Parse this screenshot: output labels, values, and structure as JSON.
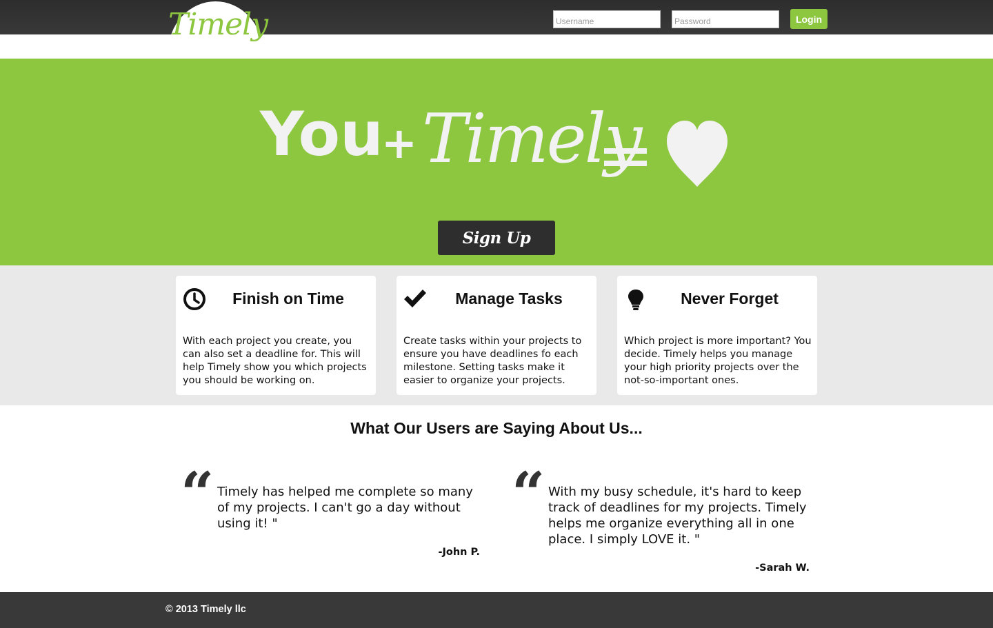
{
  "header": {
    "logo_text": "Timely",
    "username_placeholder": "Username",
    "password_placeholder": "Password",
    "login_label": "Login"
  },
  "hero": {
    "you": "You",
    "plus": "+",
    "brand": "Timely",
    "heart_icon": "heart-icon",
    "signup_label": "Sign Up"
  },
  "features": [
    {
      "icon": "clock-icon",
      "title": "Finish on Time",
      "text": "With each project you create, you can also set a deadline for. This will help Timely show you which projects you should be working on."
    },
    {
      "icon": "checkmark-icon",
      "title": "Manage Tasks",
      "text": "Create tasks within your projects to ensure you have deadlines fo each milestone. Setting tasks make it easier to organize your projects."
    },
    {
      "icon": "lightbulb-icon",
      "title": "Never Forget",
      "text": "Which project is more important? You decide. Timely helps you manage your high priority projects over the not-so-important ones."
    }
  ],
  "testimonials": {
    "heading": "What Our Users are Saying About Us...",
    "items": [
      {
        "quote_icon": "quote-icon",
        "quote_mark": "“",
        "text": "Timely has helped me complete so many of my projects. I can't go a day without using it! \"",
        "author": "-John P."
      },
      {
        "quote_icon": "quote-icon",
        "quote_mark": "“",
        "text": "With my busy schedule, it's hard to keep track of deadlines for my projects. Timely helps me organize everything all in one place. I simply LOVE it. \"",
        "author": "-Sarah W."
      }
    ]
  },
  "footer": {
    "copyright": "© 2013 Timely llc"
  },
  "colors": {
    "brand_green": "#8dc63f",
    "dark_bar": "#3a3939",
    "feature_band": "#e9e9e9",
    "hero_text": "#f2f2f2"
  }
}
